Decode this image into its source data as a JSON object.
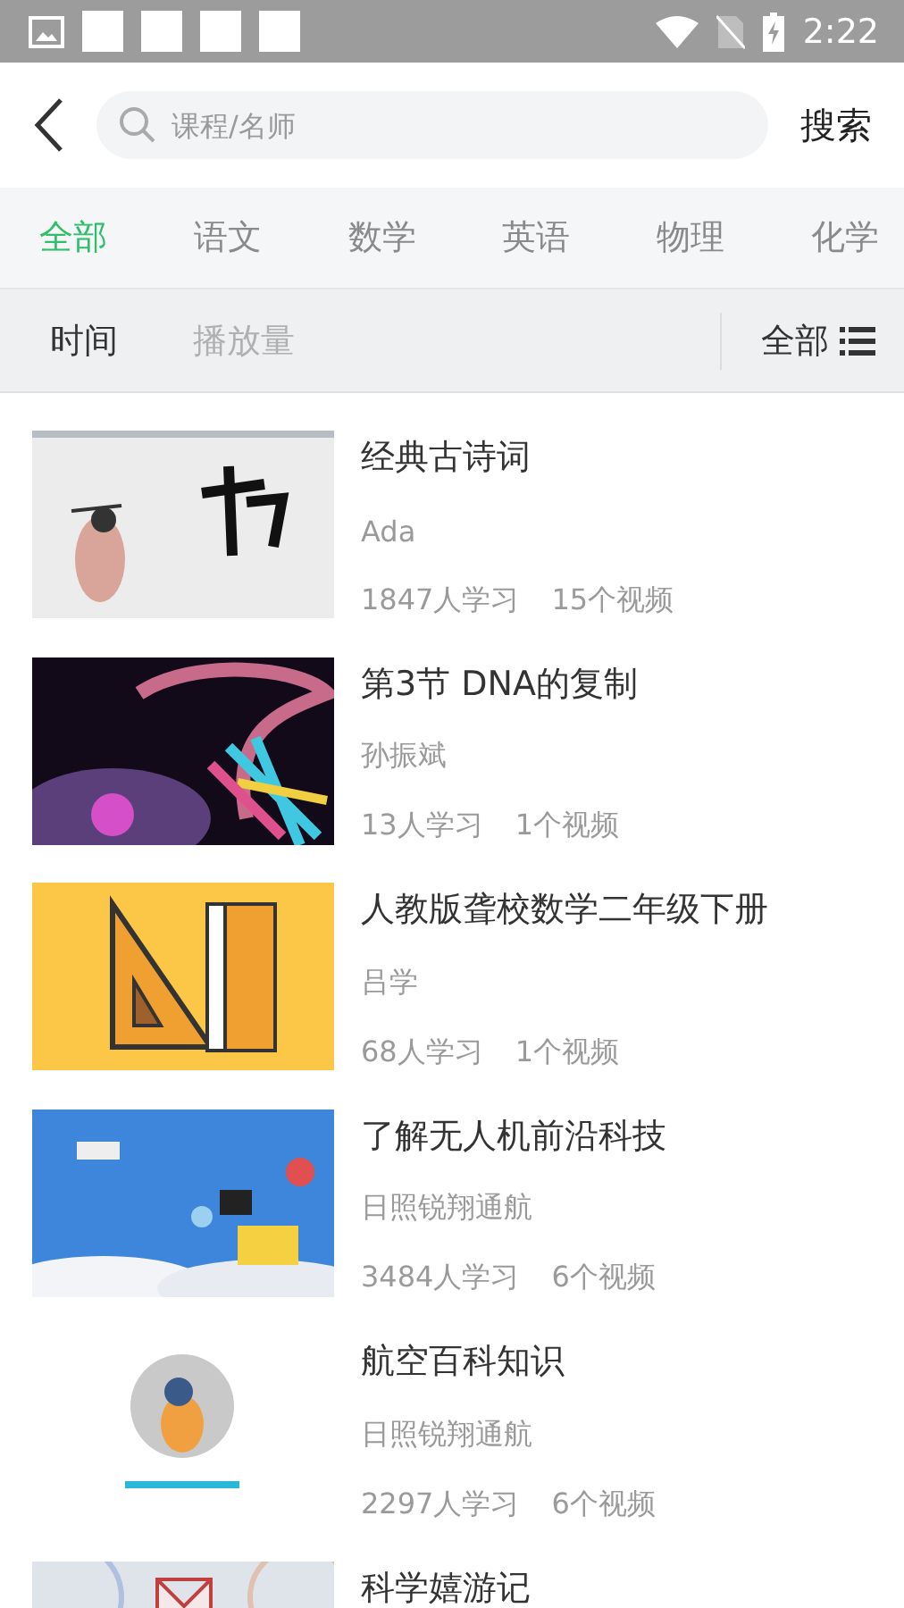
{
  "status_bar": {
    "time": "2:22"
  },
  "search": {
    "placeholder": "课程/名师",
    "button": "搜索"
  },
  "subjects": [
    {
      "label": "全部",
      "selected": true
    },
    {
      "label": "语文",
      "selected": false
    },
    {
      "label": "数学",
      "selected": false
    },
    {
      "label": "英语",
      "selected": false
    },
    {
      "label": "物理",
      "selected": false
    },
    {
      "label": "化学",
      "selected": false
    }
  ],
  "sort_options": [
    {
      "label": "时间",
      "selected": true
    },
    {
      "label": "播放量",
      "selected": false
    }
  ],
  "filter": {
    "label": "全部"
  },
  "courses": [
    {
      "title": "经典古诗词",
      "teacher": "Ada",
      "learners": "1847人学习",
      "videos": "15个视频"
    },
    {
      "title": "第3节 DNA的复制",
      "teacher": "孙振斌",
      "learners": "13人学习",
      "videos": "1个视频"
    },
    {
      "title": "人教版聋校数学二年级下册",
      "teacher": "吕学",
      "learners": "68人学习",
      "videos": "1个视频"
    },
    {
      "title": "了解无人机前沿科技",
      "teacher": "日照锐翔通航",
      "learners": "3484人学习",
      "videos": "6个视频"
    },
    {
      "title": "航空百科知识",
      "teacher": "日照锐翔通航",
      "learners": "2297人学习",
      "videos": "6个视频"
    },
    {
      "title": "科学嬉游记"
    }
  ]
}
